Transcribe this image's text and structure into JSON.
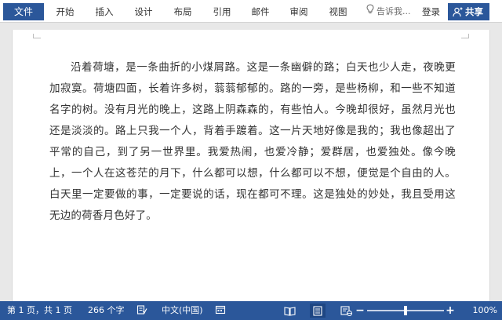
{
  "ribbon": {
    "file_label": "文件",
    "tabs": [
      {
        "label": "开始"
      },
      {
        "label": "插入"
      },
      {
        "label": "设计"
      },
      {
        "label": "布局"
      },
      {
        "label": "引用"
      },
      {
        "label": "邮件"
      },
      {
        "label": "审阅"
      },
      {
        "label": "视图"
      }
    ],
    "tell_me_placeholder": "告诉我...",
    "login_label": "登录",
    "share_label": "共享"
  },
  "document": {
    "paragraph": "沿着荷塘，是一条曲折的小煤屑路。这是一条幽僻的路；白天也少人走，夜晚更加寂寞。荷塘四面，长着许多树，蓊蓊郁郁的。路的一旁，是些杨柳，和一些不知道名字的树。没有月光的晚上，这路上阴森森的，有些怕人。今晚却很好，虽然月光也还是淡淡的。路上只我一个人，背着手踱着。这一片天地好像是我的；我也像超出了平常的自己，到了另一世界里。我爱热闹，也爱冷静；爱群居，也爱独处。像今晚上，一个人在这苍茫的月下，什么都可以想，什么都可以不想，便觉是个自由的人。白天里一定要做的事，一定要说的话，现在都可不理。这是独处的妙处，我且受用这无边的荷香月色好了。"
  },
  "status": {
    "page_info": "第 1 页，共 1 页",
    "word_count": "266 个字",
    "language": "中文(中国)",
    "zoom_label": "100%",
    "zoom_percent": 100
  },
  "colors": {
    "brand": "#2b579a",
    "active_view": "#1e4683"
  },
  "icons": {
    "tell_me": "lightbulb-icon",
    "share": "person-icon",
    "proofing": "proofing-icon",
    "macro": "macro-record-icon",
    "read_mode": "read-mode-icon",
    "print_layout": "print-layout-icon",
    "web_layout": "web-layout-icon"
  }
}
